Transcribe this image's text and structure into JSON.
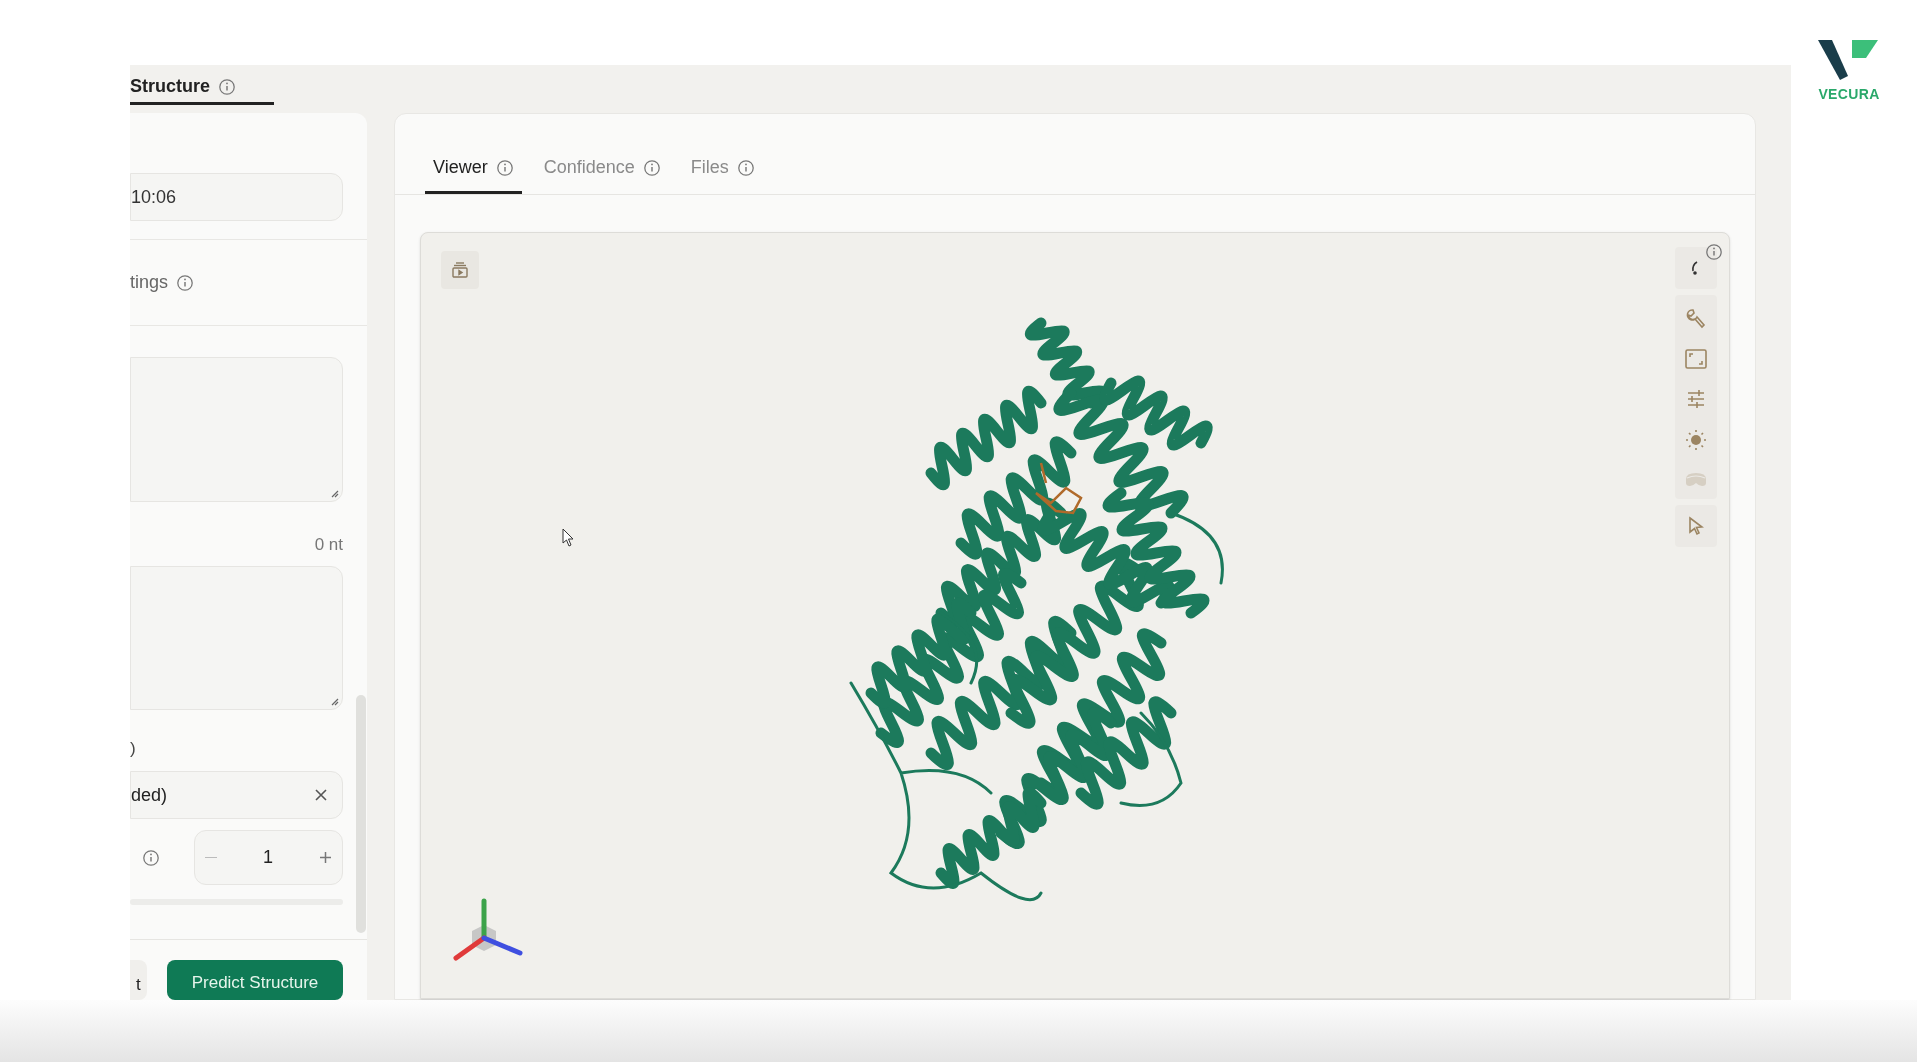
{
  "top_tab": {
    "label": "Structure",
    "selected": true
  },
  "left_panel": {
    "time_field": {
      "value": "10:06"
    },
    "settings_label": "tings",
    "sequence_count": "0 nt",
    "paren_label": ")",
    "selected_field": {
      "value": "ded)"
    },
    "stepper": {
      "value": "1"
    },
    "buttons": [
      "t",
      "Predict Structure"
    ]
  },
  "tabs": [
    {
      "label": "Viewer",
      "selected": true
    },
    {
      "label": "Confidence",
      "selected": false
    },
    {
      "label": "Files",
      "selected": false
    }
  ],
  "logo": {
    "text": "VECURA"
  }
}
